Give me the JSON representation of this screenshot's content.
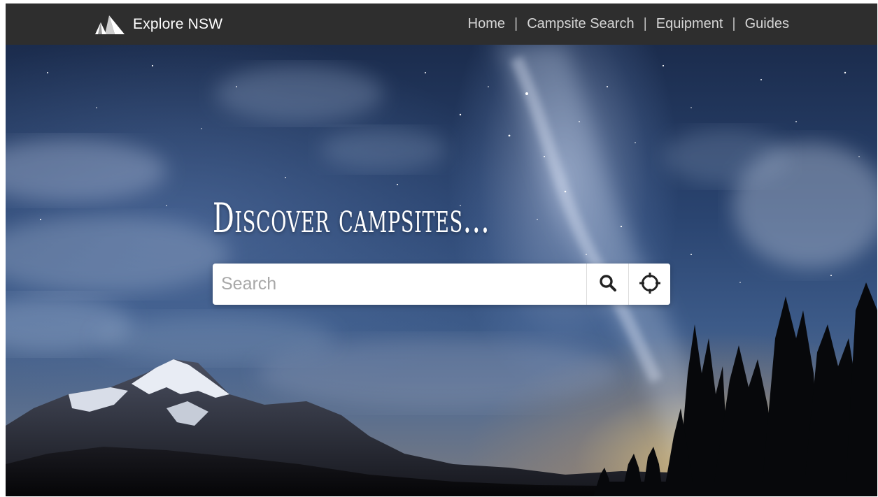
{
  "brand": {
    "name": "Explore NSW",
    "logo_icon": "tent-mountain-icon"
  },
  "nav": {
    "items": [
      {
        "label": "Home"
      },
      {
        "label": "Campsite Search"
      },
      {
        "label": "Equipment"
      },
      {
        "label": "Guides"
      }
    ],
    "separator": "|"
  },
  "hero": {
    "headline": "Discover campsites...",
    "search": {
      "placeholder": "Search",
      "value": ""
    },
    "search_icon": "search-icon",
    "locate_icon": "crosshair-icon"
  },
  "colors": {
    "navbar_bg": "#2e2e2e",
    "nav_text": "#d6d6d6",
    "sky_top": "#1b2c4d",
    "sky_mid": "#3c5a88",
    "horizon_glow": "#ffd678"
  }
}
